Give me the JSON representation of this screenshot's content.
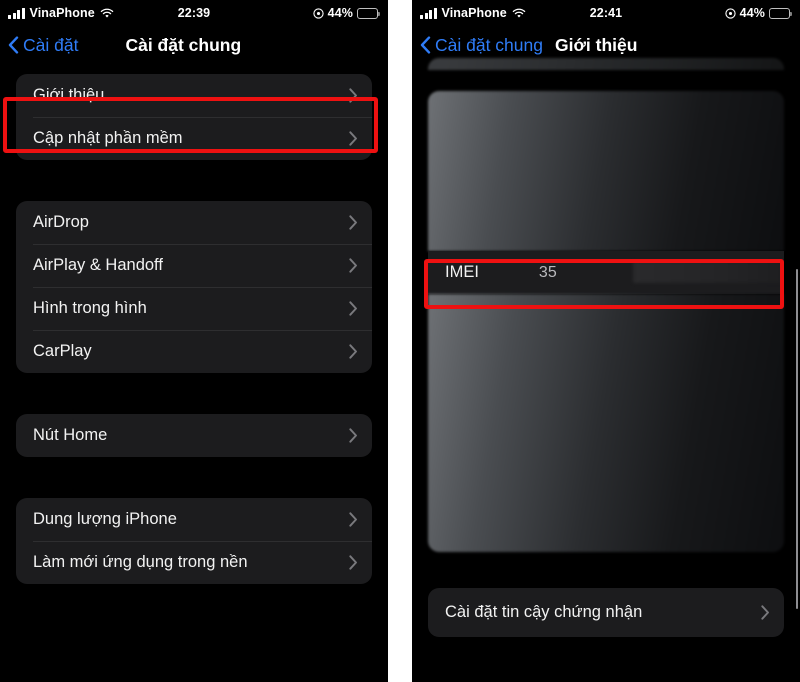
{
  "left_phone": {
    "status_bar": {
      "carrier": "VinaPhone",
      "time": "22:39",
      "battery_percent": "44%",
      "battery_level": 44,
      "signal_icon": "signal-bars-icon",
      "wifi_icon": "wifi-icon",
      "location_icon": "location-arrow-icon"
    },
    "nav": {
      "back_label": "Cài đặt",
      "back_icon": "chevron-left-icon",
      "title": "Cài đặt chung"
    },
    "groups": [
      {
        "rows": [
          {
            "label": "Giới thiệu",
            "accessory": "chevron-right-icon",
            "highlighted": true
          },
          {
            "label": "Cập nhật phần mềm",
            "accessory": "chevron-right-icon",
            "highlighted": false
          }
        ]
      },
      {
        "rows": [
          {
            "label": "AirDrop",
            "accessory": "chevron-right-icon",
            "highlighted": false
          },
          {
            "label": "AirPlay & Handoff",
            "accessory": "chevron-right-icon",
            "highlighted": false
          },
          {
            "label": "Hình trong hình",
            "accessory": "chevron-right-icon",
            "highlighted": false
          },
          {
            "label": "CarPlay",
            "accessory": "chevron-right-icon",
            "highlighted": false
          }
        ]
      },
      {
        "rows": [
          {
            "label": "Nút Home",
            "accessory": "chevron-right-icon",
            "highlighted": false
          }
        ]
      },
      {
        "rows": [
          {
            "label": "Dung lượng iPhone",
            "accessory": "chevron-right-icon",
            "highlighted": false
          },
          {
            "label": "Làm mới ứng dụng trong nền",
            "accessory": "chevron-right-icon",
            "highlighted": false
          }
        ]
      }
    ]
  },
  "right_phone": {
    "status_bar": {
      "carrier": "VinaPhone",
      "time": "22:41",
      "battery_percent": "44%",
      "battery_level": 44,
      "signal_icon": "signal-bars-icon",
      "wifi_icon": "wifi-icon",
      "location_icon": "location-arrow-icon"
    },
    "nav": {
      "back_label": "Cài đặt chung",
      "back_icon": "chevron-left-icon",
      "title": "Giới thiệu"
    },
    "imei_row": {
      "label": "IMEI",
      "value": "35",
      "highlighted": true
    },
    "bottom_row": {
      "label": "Cài đặt tin cậy chứng nhận",
      "accessory": "chevron-right-icon"
    },
    "obscured_note": "blurred content"
  },
  "annotation": {
    "highlight_color": "#ee1111",
    "highlight_count": 2
  },
  "theme": {
    "background": "#000000",
    "card_background": "#1c1c1e",
    "separator": "#2e2e30",
    "primary_text": "#f2f2f2",
    "secondary_text": "#b9b9bd",
    "tint_blue": "#2f7cf6",
    "gutter": "#ffffff"
  }
}
